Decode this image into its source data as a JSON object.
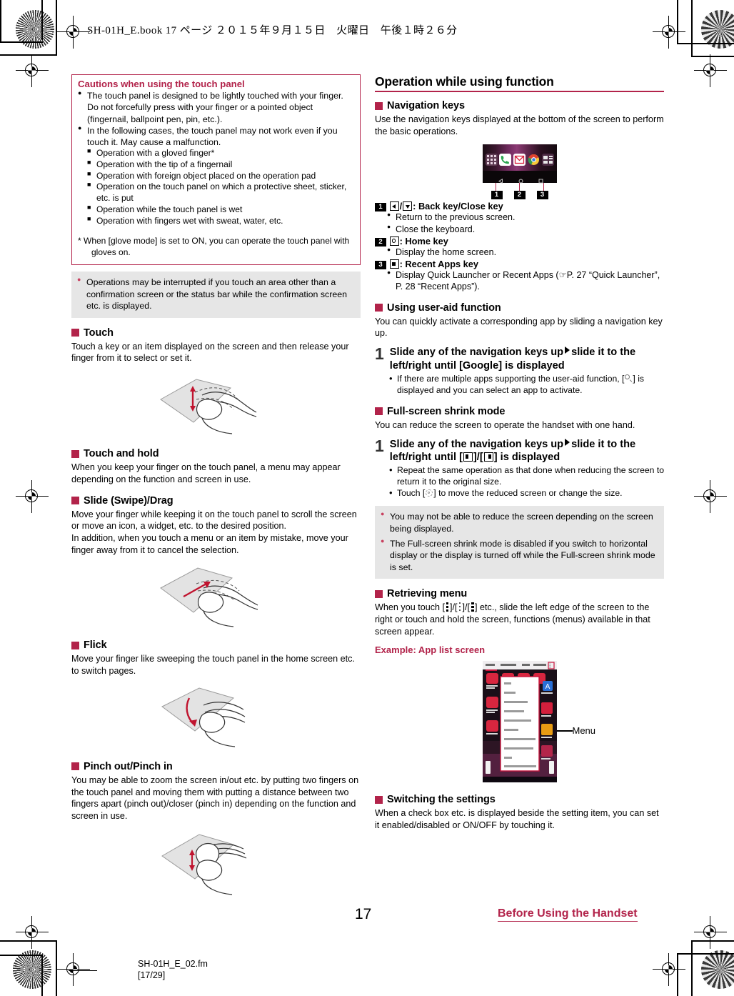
{
  "print": {
    "header_slug": "SH-01H_E.book  17 ページ  ２０１５年９月１５日　火曜日　午後１時２６分",
    "file_name": "SH-01H_E_02.fm",
    "file_page": "[17/29]"
  },
  "footer": {
    "page_number": "17",
    "section_title": "Before Using the Handset",
    "accent": "#b2234a"
  },
  "left_column": {
    "caution_box": {
      "title": "Cautions when using the touch panel",
      "bullets": [
        "The touch panel is designed to be lightly touched with your finger. Do not forcefully press with your finger or a pointed object (fingernail, ballpoint pen, pin, etc.).",
        "In the following cases, the touch panel may not work even if you touch it. May cause a malfunction."
      ],
      "sub_bullets": [
        "Operation with a gloved finger*",
        "Operation with the tip of a fingernail",
        "Operation with foreign object placed on the operation pad",
        "Operation on the touch panel on which a protective sheet, sticker, etc. is put",
        "Operation while the touch panel is wet",
        "Operation with fingers wet with sweat, water, etc."
      ],
      "footnote": "*  When [glove mode] is set to ON, you can operate the touch panel with gloves on."
    },
    "note_box": {
      "bullets": [
        "Operations may be interrupted if you touch an area other than a confirmation screen or the status bar while the confirmation screen etc. is displayed."
      ]
    },
    "sections": [
      {
        "heading": "Touch",
        "body": "Touch a key or an item displayed on the screen and then release your finger from it to select or set it.",
        "figure": "hand-touch-illustration"
      },
      {
        "heading": "Touch and hold",
        "body": "When you keep your finger on the touch panel, a menu may appear depending on the function and screen in use.",
        "figure": ""
      },
      {
        "heading": "Slide (Swipe)/Drag",
        "body": "Move your finger while keeping it on the touch panel to scroll the screen or move an icon, a widget, etc. to the desired position.\nIn addition, when you touch a menu or an item by mistake, move your finger away from it to cancel the selection.",
        "figure": "hand-slide-illustration"
      },
      {
        "heading": "Flick",
        "body": "Move your finger like sweeping the touch panel in the home screen etc. to switch pages.",
        "figure": "hand-flick-illustration"
      },
      {
        "heading": "Pinch out/Pinch in",
        "body": "You may be able to zoom the screen in/out etc. by putting two fingers on the touch panel and moving them with putting a distance between two fingers apart (pinch out)/closer (pinch in) depending on the function and screen in use.",
        "figure": "hand-pinch-illustration"
      }
    ]
  },
  "right_column": {
    "title": "Operation while using function",
    "nav_keys": {
      "heading": "Navigation keys",
      "body": "Use the navigation keys displayed at the bottom of the screen to perform the basic operations.",
      "figure_callouts": [
        "1",
        "2",
        "3"
      ],
      "key_definitions": [
        {
          "num": "1",
          "label": ": Back key/Close key",
          "bullets": [
            "Return to the previous screen.",
            "Close the keyboard."
          ]
        },
        {
          "num": "2",
          "label": ": Home key",
          "bullets": [
            "Display the home screen."
          ]
        },
        {
          "num": "3",
          "label": ": Recent Apps key",
          "bullets": [
            "Display Quick Launcher or Recent Apps (☞P. 27 “Quick Launcher”, P. 28 “Recent Apps”)."
          ]
        }
      ]
    },
    "user_aid": {
      "heading": "Using user-aid function",
      "body": "You can quickly activate a corresponding app by sliding a navigation key up.",
      "step_num": "1",
      "step_text_a": "Slide any of the navigation keys up",
      "step_text_b": "slide it to the left/right until [Google] is displayed",
      "sub_bullet_a": "If there are multiple apps supporting the user-aid function,",
      "sub_bullet_b": "] is displayed and you can select an app to activate."
    },
    "shrink_mode": {
      "heading": "Full-screen shrink mode",
      "body": "You can reduce the screen to operate the handset with one hand.",
      "step_num": "1",
      "step_text_a": "Slide any of the navigation keys up",
      "step_text_b": "slide it to",
      "step_text_c": "the left/right until [",
      "step_text_d": "]/[",
      "step_text_e": "] is displayed",
      "sub_bullets": [
        "Repeat the same operation as that done when reducing the screen to return it to the original size.",
        "] to move the reduced screen or change the size."
      ],
      "sub_bullet_touch_prefix": "Touch [",
      "note_bullets": [
        "You may not be able to reduce the screen depending on the screen being displayed.",
        "The Full-screen shrink mode is disabled if you switch to horizontal display or the display is turned off while the Full-screen shrink mode is set."
      ]
    },
    "retrieving_menu": {
      "heading": "Retrieving menu",
      "body_a": "When you touch [",
      "body_b": "]/[",
      "body_c": "]/[",
      "body_d": "] etc., slide the left edge of the screen to the right or touch and hold the screen, functions (menus) available in that screen appear.",
      "example_label": "Example: App list screen",
      "callout_label": "Menu"
    },
    "switching_settings": {
      "heading": "Switching the settings",
      "body": "When a check box etc. is displayed beside the setting item, you can set it enabled/disabled or ON/OFF by touching it."
    }
  }
}
